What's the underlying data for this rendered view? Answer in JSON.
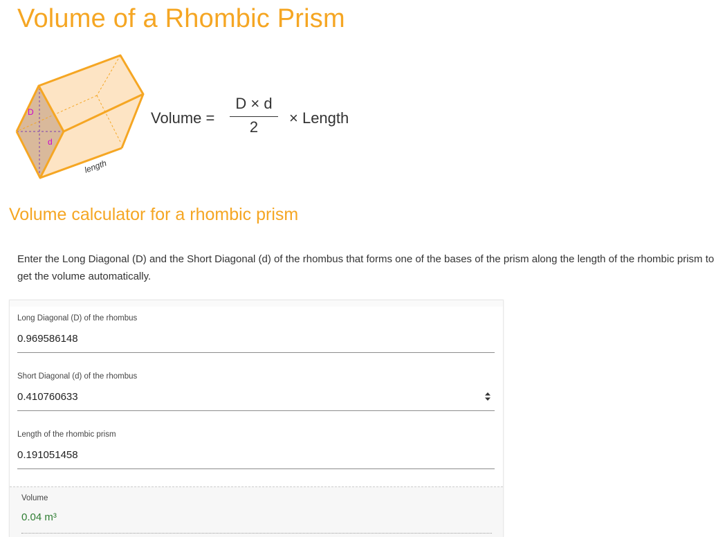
{
  "page": {
    "title": "Volume of a Rhombic Prism"
  },
  "diagram": {
    "label_long_diagonal": "D",
    "label_short_diagonal": "d",
    "label_length": "length"
  },
  "formula": {
    "lhs": "Volume =",
    "numerator": "D × d",
    "denominator": "2",
    "rhs": "× Length"
  },
  "calculator": {
    "heading": "Volume calculator for a rhombic prism",
    "intro": "Enter the Long Diagonal (D) and the Short Diagonal (d) of the rhombus that forms one of the bases of the prism along the length of the rhombic prism to get the volume automatically.",
    "fields": [
      {
        "label": "Long Diagonal (D) of the rhombus",
        "value": "0.969586148"
      },
      {
        "label": "Short Diagonal (d) of the rhombus",
        "value": "0.410760633"
      },
      {
        "label": "Length of the rhombic prism",
        "value": "0.191051458"
      }
    ],
    "result": {
      "label": "Volume",
      "value": "0.04 m³"
    }
  },
  "colors": {
    "accent": "#f5a623",
    "result": "#2e7d32",
    "diagonal_labels": "#cc00cc"
  }
}
